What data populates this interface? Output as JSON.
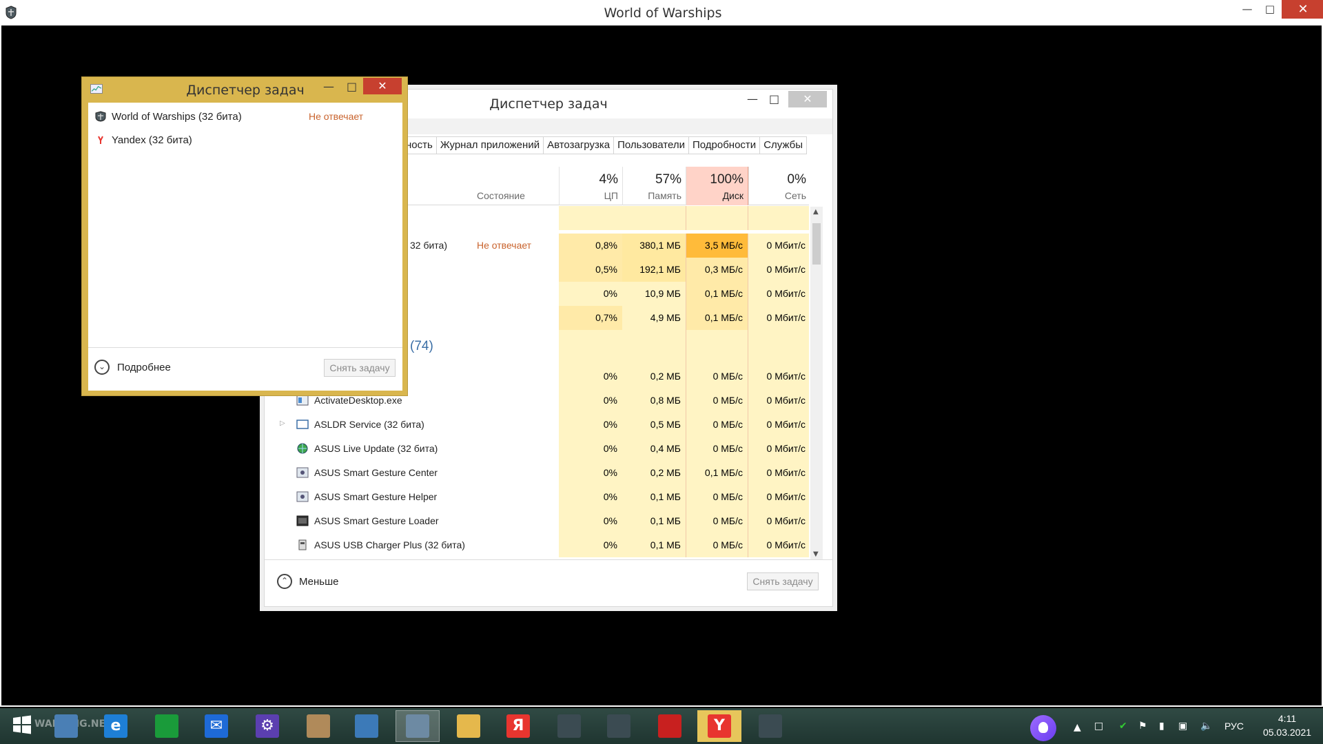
{
  "game_window": {
    "title": "World of Warships",
    "min_icon": "minimize-icon",
    "max_icon": "maximize-icon",
    "close_icon": "close-icon"
  },
  "tm_big": {
    "title": "Диспетчер задач",
    "tabs": [
      "ность",
      "Журнал приложений",
      "Автозагрузка",
      "Пользователи",
      "Подробности",
      "Службы"
    ],
    "columns": {
      "state": "Состояние",
      "cpu_pct": "4%",
      "cpu_lbl": "ЦП",
      "mem_pct": "57%",
      "mem_lbl": "Память",
      "disk_pct": "100%",
      "disk_lbl": "Диск",
      "net_pct": "0%",
      "net_lbl": "Сеть"
    },
    "app_rows": [
      {
        "name": "32 бита)",
        "state": "Не отвечает",
        "cpu": "0,8%",
        "mem": "380,1 МБ",
        "disk": "3,5 МБ/с",
        "net": "0 Мбит/с"
      },
      {
        "name": "",
        "state": "",
        "cpu": "0,5%",
        "mem": "192,1 МБ",
        "disk": "0,3 МБ/с",
        "net": "0 Мбит/с"
      },
      {
        "name": "",
        "state": "",
        "cpu": "0%",
        "mem": "10,9 МБ",
        "disk": "0,1 МБ/с",
        "net": "0 Мбит/с"
      },
      {
        "name": "",
        "state": "",
        "cpu": "0,7%",
        "mem": "4,9 МБ",
        "disk": "0,1 МБ/с",
        "net": "0 Мбит/с"
      }
    ],
    "group_label": "(74)",
    "bg_rows": [
      {
        "name": "",
        "cpu": "0%",
        "mem": "0,2 МБ",
        "disk": "0 МБ/с",
        "net": "0 Мбит/с"
      },
      {
        "name": "ActivateDesktop.exe",
        "cpu": "0%",
        "mem": "0,8 МБ",
        "disk": "0 МБ/с",
        "net": "0 Мбит/с"
      },
      {
        "name": "ASLDR Service (32 бита)",
        "cpu": "0%",
        "mem": "0,5 МБ",
        "disk": "0 МБ/с",
        "net": "0 Мбит/с"
      },
      {
        "name": "ASUS Live Update (32 бита)",
        "cpu": "0%",
        "mem": "0,4 МБ",
        "disk": "0 МБ/с",
        "net": "0 Мбит/с"
      },
      {
        "name": "ASUS Smart Gesture Center",
        "cpu": "0%",
        "mem": "0,2 МБ",
        "disk": "0,1 МБ/с",
        "net": "0 Мбит/с"
      },
      {
        "name": "ASUS Smart Gesture Helper",
        "cpu": "0%",
        "mem": "0,1 МБ",
        "disk": "0 МБ/с",
        "net": "0 Мбит/с"
      },
      {
        "name": "ASUS Smart Gesture Loader",
        "cpu": "0%",
        "mem": "0,1 МБ",
        "disk": "0 МБ/с",
        "net": "0 Мбит/с"
      },
      {
        "name": "ASUS USB Charger Plus (32 бита)",
        "cpu": "0%",
        "mem": "0,1 МБ",
        "disk": "0 МБ/с",
        "net": "0 Мбит/с"
      }
    ],
    "less_label": "Меньше",
    "end_task": "Снять задачу"
  },
  "tm_small": {
    "title": "Диспетчер задач",
    "items": [
      {
        "name": "World of Warships (32 бита)",
        "state": "Не отвечает"
      },
      {
        "name": "Yandex (32 бита)",
        "state": ""
      }
    ],
    "more_label": "Подробнее",
    "end_task": "Снять задачу"
  },
  "taskbar": {
    "watermark": "WARNING.NE",
    "lang": "РУС",
    "time": "4:11",
    "date": "05.03.2021",
    "apps": [
      {
        "icon": "windows-start-icon",
        "glyph": "",
        "color": "#3a78c9"
      },
      {
        "icon": "computer-icon",
        "glyph": "",
        "color": "#4a7fb5"
      },
      {
        "icon": "internet-explorer-icon",
        "glyph": "e",
        "color": "#1e7fd6"
      },
      {
        "icon": "store-icon",
        "glyph": "",
        "color": "#1a9b3a"
      },
      {
        "icon": "mail-icon",
        "glyph": "✉",
        "color": "#1e6ad6"
      },
      {
        "icon": "settings-icon",
        "glyph": "⚙",
        "color": "#5b3fb0"
      },
      {
        "icon": "paint-icon",
        "glyph": "",
        "color": "#b08a5a"
      },
      {
        "icon": "control-panel-icon",
        "glyph": "",
        "color": "#3c7ab8"
      },
      {
        "icon": "task-manager-icon",
        "glyph": "",
        "color": "#6d8aa3"
      },
      {
        "icon": "file-explorer-icon",
        "glyph": "",
        "color": "#e5b84c"
      },
      {
        "icon": "yandex-browser-icon",
        "glyph": "Я",
        "color": "#e8352f"
      },
      {
        "icon": "world-of-warships-icon",
        "glyph": "",
        "color": "#3b4b52"
      },
      {
        "icon": "world-of-warships-icon",
        "glyph": "",
        "color": "#3b4b52"
      },
      {
        "icon": "wargaming-icon",
        "glyph": "",
        "color": "#c8201f"
      },
      {
        "icon": "yandex-icon",
        "glyph": "Y",
        "color": "#e8352f"
      },
      {
        "icon": "world-of-warships-icon",
        "glyph": "",
        "color": "#3b4b52"
      }
    ]
  }
}
